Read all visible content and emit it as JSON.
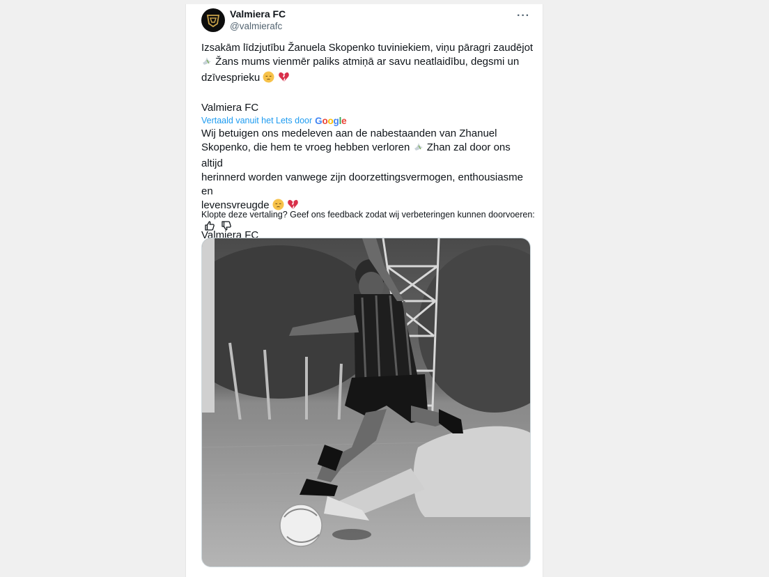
{
  "author": {
    "name": "Valmiera FC",
    "handle": "@valmierafc",
    "avatar_icon": "valmiera-fc-logo-icon"
  },
  "more_icon": "more-horizontal-icon",
  "original": {
    "line1": "Izsakām līdzjutību Žanuela Skopenko tuviniekiem, viņu pāragri zaudējot",
    "line2": " Žans mums vienmēr paliks atmiņā ar savu neatlaidību, degsmi un",
    "line3": "dzīvesprieku ",
    "signature": "Valmiera FC"
  },
  "translation": {
    "label": "Vertaald vanuit het Lets door",
    "provider": "Google",
    "line1": "Wij betuigen ons medeleven aan de nabestaanden van Zhanuel",
    "line2": "Skopenko, die hem te vroeg hebben verloren ",
    "line2b": " Zhan zal door ons altijd",
    "line3": "herinnerd worden vanwege zijn doorzettingsvermogen, enthousiasme en",
    "line4": "levensvreugde ",
    "signature": "Valmiera FC"
  },
  "feedback": {
    "question": "Klopte deze vertaling? Geef ons feedback zodat wij verbeteringen kunnen doorvoeren:",
    "thumbs_up_icon": "thumbs-up-icon",
    "thumbs_down_icon": "thumbs-down-icon"
  },
  "emojis": [
    "dove-icon",
    "pensive-face-icon",
    "broken-heart-icon"
  ],
  "colors": {
    "link": "#1d9bf0",
    "text": "#0f1419",
    "secondary": "#536471",
    "broken_heart": "#d9304a",
    "pensive": "#f7c24a"
  }
}
